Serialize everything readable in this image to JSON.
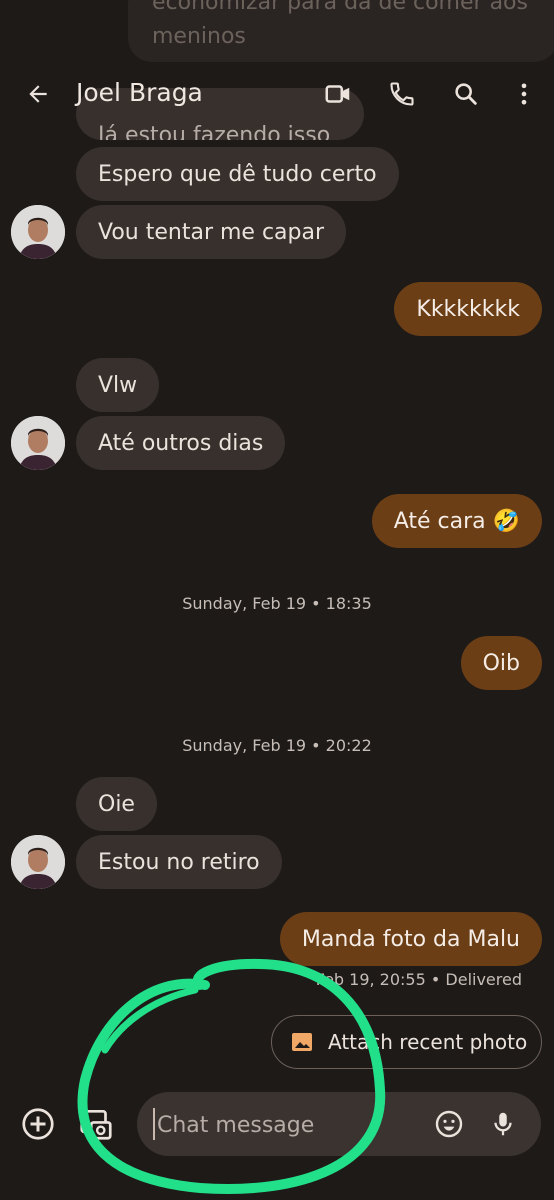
{
  "partial_message": "economizar para da de comer aos meninos",
  "header": {
    "back_icon": "arrow-back-icon",
    "contact_name": "Joel Braga",
    "video_icon": "video-call-icon",
    "phone_icon": "phone-icon",
    "search_icon": "search-icon",
    "more_icon": "more-vert-icon"
  },
  "messages": [
    {
      "text": "Já estou fazendo isso",
      "direction": "in"
    },
    {
      "text": "Espero que dê tudo certo",
      "direction": "in"
    },
    {
      "text": "Vou tentar me capar",
      "direction": "in"
    },
    {
      "text": "Kkkkkkkk",
      "direction": "out"
    },
    {
      "text": "Vlw",
      "direction": "in"
    },
    {
      "text": "Até outros dias",
      "direction": "in"
    },
    {
      "text": "Até cara 🤣",
      "direction": "out"
    },
    {
      "text": "Oib",
      "direction": "out"
    },
    {
      "text": "Oie",
      "direction": "in"
    },
    {
      "text": "Estou no retiro",
      "direction": "in"
    },
    {
      "text": "Manda foto da Malu",
      "direction": "out"
    }
  ],
  "dates": [
    "Sunday, Feb 19 • 18:35",
    "Sunday, Feb 19 • 20:22"
  ],
  "last_status": "Feb 19, 20:55 • Delivered",
  "attach_suggestion": {
    "label": "Attach recent photo",
    "icon": "image-icon"
  },
  "composer": {
    "placeholder": "Chat message",
    "add_icon": "add-circle-icon",
    "gallery_icon": "gallery-camera-icon",
    "emoji_icon": "emoji-icon",
    "mic_icon": "microphone-icon"
  },
  "colors": {
    "background": "#1d1a18",
    "incoming_bubble": "#37302d",
    "outgoing_bubble": "#6b3e15",
    "annotation": "#22e08a"
  }
}
